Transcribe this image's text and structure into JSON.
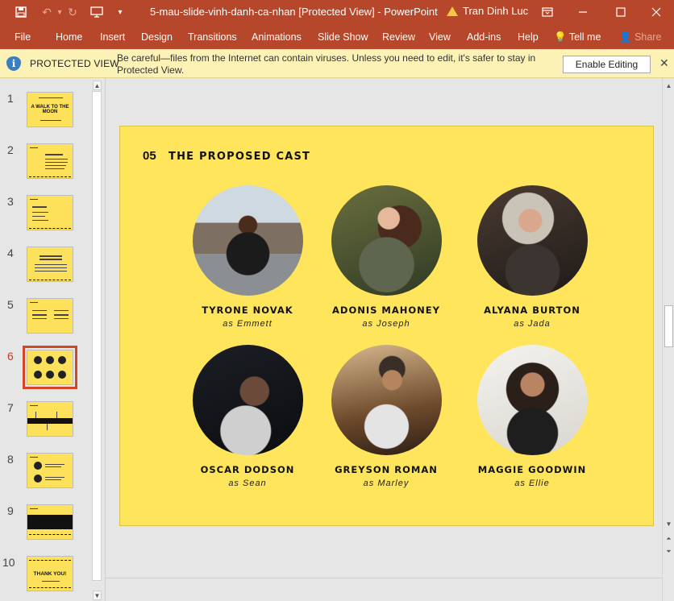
{
  "titlebar": {
    "doc_title": "5-mau-slide-vinh-danh-ca-nhan [Protected View]  -  PowerPoint",
    "user": "Tran Dinh Luc",
    "icons": [
      "save-icon",
      "undo-icon",
      "redo-icon",
      "present-from-start-icon",
      "customize-qat-icon",
      "ribbon-display-icon",
      "minimize-icon",
      "maximize-icon",
      "close-icon"
    ]
  },
  "ribbon": {
    "tabs": [
      "File",
      "Home",
      "Insert",
      "Design",
      "Transitions",
      "Animations",
      "Slide Show",
      "Review",
      "View",
      "Add-ins",
      "Help"
    ],
    "tell_me": "Tell me",
    "share": "Share"
  },
  "protected_view": {
    "title": "PROTECTED VIEW",
    "message": "Be careful—files from the Internet can contain viruses. Unless you need to edit, it's safer to stay in Protected View.",
    "enable_button": "Enable Editing",
    "close_glyph": "✕"
  },
  "slides": {
    "active_index": 6,
    "numbers": [
      "1",
      "2",
      "3",
      "4",
      "5",
      "6",
      "7",
      "8",
      "9",
      "10"
    ],
    "thumb_titles": {
      "1": "A WALK TO THE MOON",
      "10": "THANK YOU!"
    }
  },
  "current_slide": {
    "number": "05",
    "title": "THE PROPOSED CAST",
    "cast": [
      {
        "name": "TYRONE NOVAK",
        "role": "as Emmett"
      },
      {
        "name": "ADONIS MAHONEY",
        "role": "as Joseph"
      },
      {
        "name": "ALYANA BURTON",
        "role": "as Jada"
      },
      {
        "name": "OSCAR DODSON",
        "role": "as Sean"
      },
      {
        "name": "GREYSON ROMAN",
        "role": "as Marley"
      },
      {
        "name": "MAGGIE GOODWIN",
        "role": "as Ellie"
      }
    ]
  },
  "colors": {
    "ribbon": "#b7472a",
    "slide_bg": "#ffe55c",
    "protected_bar": "#fdf2b6",
    "active_thumb_outline": "#d24726"
  }
}
